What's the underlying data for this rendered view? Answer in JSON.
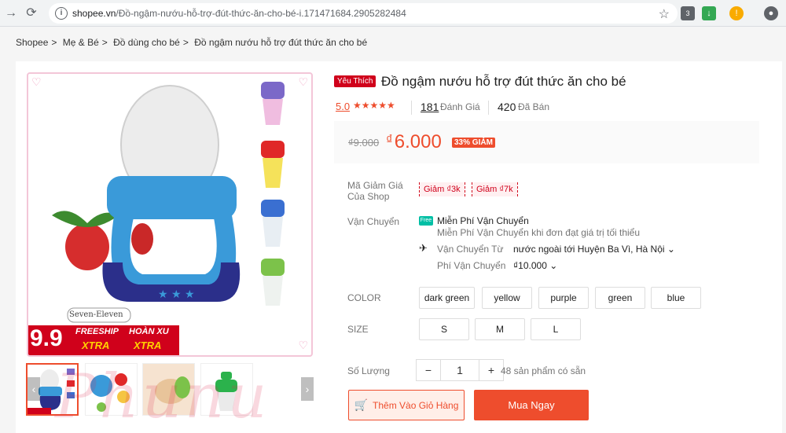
{
  "browser": {
    "url_host": "shopee.vn",
    "url_path": "/Đồ-ngậm-nướu-hỗ-trợ-đút-thức-ăn-cho-bé-i.171471684.2905282484",
    "extension_badge": "3"
  },
  "breadcrumb": [
    "Shopee",
    "Mẹ & Bé",
    "Đồ dùng cho bé",
    "Đồ ngậm nướu hỗ trợ đút thức ăn cho bé"
  ],
  "gallery": {
    "promo": {
      "brand": "Seven-Eleven",
      "sale": "9.9",
      "freeship": "FREESHIP",
      "hoanxu": "HOÀN XU",
      "xtra1": "XTRA",
      "xtra2": "XTRA"
    },
    "watermark": "Phunu"
  },
  "product": {
    "badge": "Yêu Thích",
    "title": "Đồ ngậm nướu hỗ trợ đút thức ăn cho bé",
    "rating": "5.0",
    "stars": "★★★★★",
    "rating_count": "181",
    "rating_label": "Đánh Giá",
    "sold_count": "420",
    "sold_label": "Đã Bán",
    "old_price": "₫9.000",
    "currency": "₫",
    "price": "6.000",
    "discount": "33% GIẢM"
  },
  "vouchers": {
    "label": "Mã Giảm Giá Của Shop",
    "items": [
      "Giảm ₫3k",
      "Giảm ₫7k"
    ]
  },
  "shipping": {
    "label": "Vận Chuyển",
    "free_icon_text": "Free",
    "free_title": "Miễn Phí Vận Chuyển",
    "free_desc": "Miễn Phí Vận Chuyển khi đơn đạt giá trị tối thiểu",
    "from_label": "Vận Chuyển Từ",
    "from_value": "nước ngoài tới Huyện Ba Vì, Hà Nội",
    "fee_label": "Phí Vận Chuyển",
    "fee_value": "₫10.000"
  },
  "color": {
    "label": "COLOR",
    "options": [
      "dark green",
      "yellow",
      "purple",
      "green",
      "blue"
    ]
  },
  "size": {
    "label": "SIZE",
    "options": [
      "S",
      "M",
      "L"
    ]
  },
  "quantity": {
    "label": "Số Lượng",
    "minus": "−",
    "value": "1",
    "plus": "+",
    "stock": "48 sản phẩm có sẵn"
  },
  "actions": {
    "add_to_cart": "Thêm Vào Giỏ Hàng",
    "buy_now": "Mua Ngay"
  },
  "colors": {
    "accent": "#ee4d2d",
    "teether_blue": "#3a9ad9",
    "teether_navy": "#2b2f8a"
  }
}
